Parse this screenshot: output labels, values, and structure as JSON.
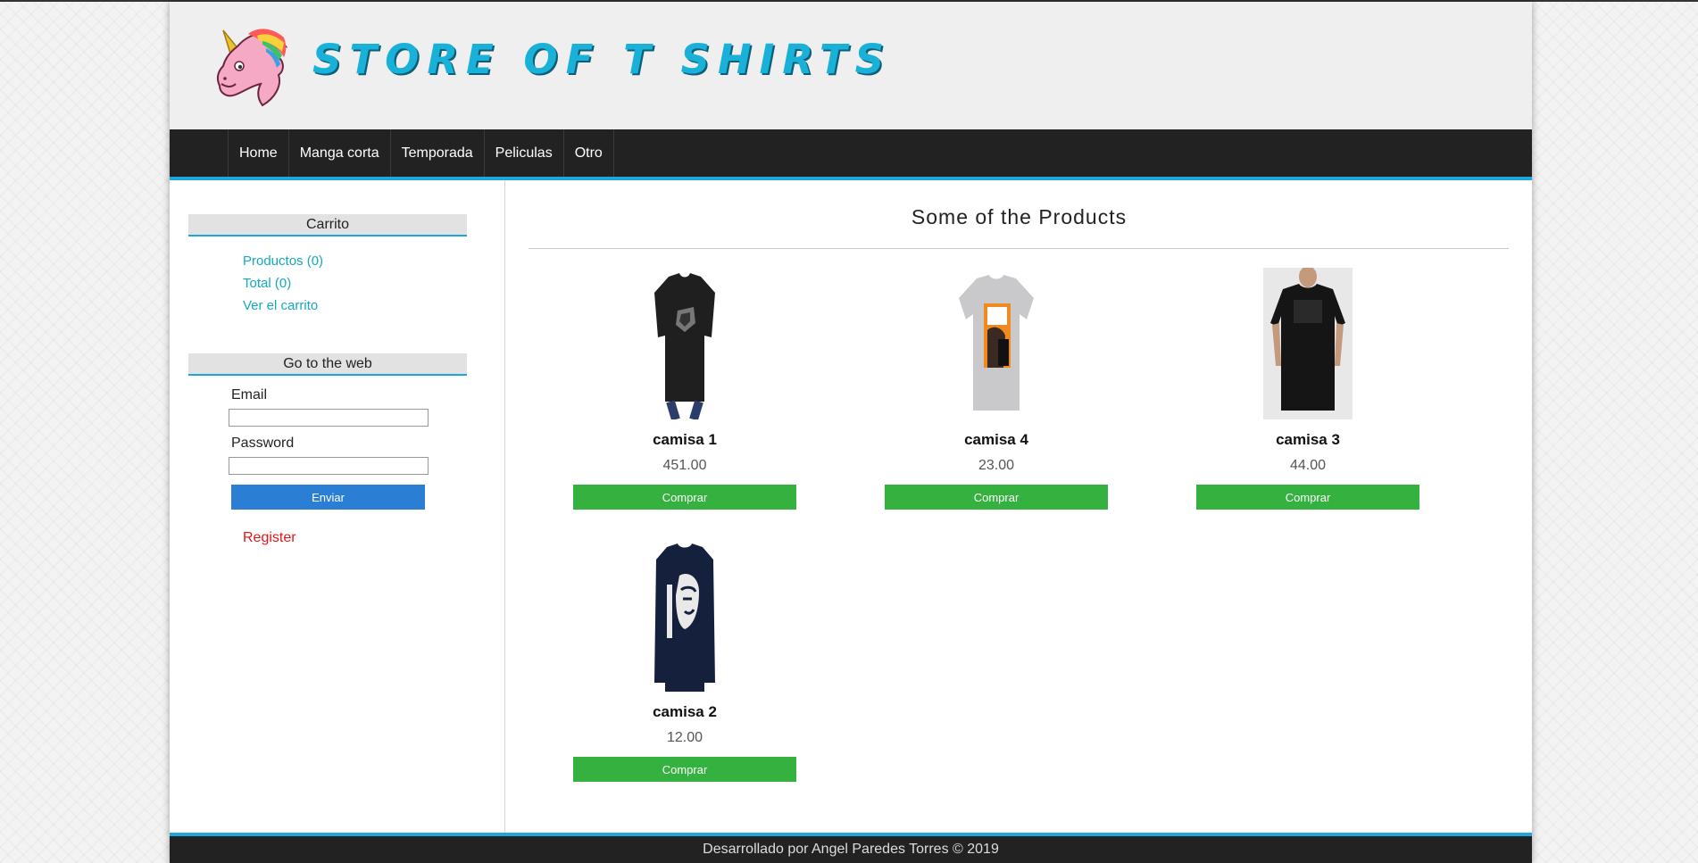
{
  "header": {
    "logo_icon": "unicorn-logo-icon",
    "site_title": "STORE OF T SHIRTS"
  },
  "nav": {
    "items": [
      {
        "label": "Home"
      },
      {
        "label": "Manga corta"
      },
      {
        "label": "Temporada"
      },
      {
        "label": "Peliculas"
      },
      {
        "label": "Otro"
      }
    ]
  },
  "sidebar": {
    "cart": {
      "heading": "Carrito",
      "products_link": "Productos (0)",
      "total_link": "Total (0)",
      "view_cart_link": "Ver el carrito"
    },
    "login": {
      "heading": "Go to the web",
      "email_label": "Email",
      "email_value": "",
      "password_label": "Password",
      "password_value": "",
      "submit_label": "Enviar",
      "register_link": "Register"
    }
  },
  "main": {
    "title": "Some of the Products",
    "products": [
      {
        "name": "camisa 1",
        "price": "451.00",
        "buy_label": "Comprar",
        "image": "black-tshirt-image"
      },
      {
        "name": "camisa 4",
        "price": "23.00",
        "buy_label": "Comprar",
        "image": "grey-tshirt-image"
      },
      {
        "name": "camisa 3",
        "price": "44.00",
        "buy_label": "Comprar",
        "image": "model-black-tshirt-image"
      },
      {
        "name": "camisa 2",
        "price": "12.00",
        "buy_label": "Comprar",
        "image": "navy-longsleeve-tshirt-image"
      }
    ]
  },
  "footer": {
    "text": "Desarrollado por Angel Paredes Torres © 2019"
  },
  "colors": {
    "accent": "#1ea7dc",
    "link": "#14a8c4",
    "register": "#e01616",
    "buy_button": "#35b13f",
    "submit_button": "#2a7fd4",
    "nav_bg": "#222222"
  }
}
